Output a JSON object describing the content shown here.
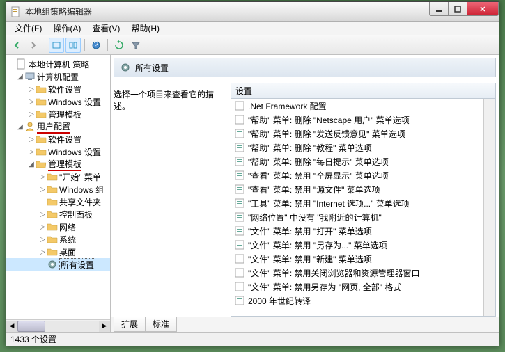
{
  "window": {
    "title": "本地组策略编辑器"
  },
  "menu": {
    "file": "文件(F)",
    "action": "操作(A)",
    "view": "查看(V)",
    "help": "帮助(H)"
  },
  "tree": {
    "root": "本地计算机 策略",
    "computer_config": "计算机配置",
    "cc_software": "软件设置",
    "cc_windows": "Windows 设置",
    "cc_admin": "管理模板",
    "user_config": "用户配置",
    "uc_software": "软件设置",
    "uc_windows": "Windows 设置",
    "uc_admin": "管理模板",
    "start_menu": "\"开始\" 菜单",
    "windows_comp": "Windows 组",
    "shared_folders": "共享文件夹",
    "control_panel": "控制面板",
    "network": "网络",
    "system": "系统",
    "desktop": "桌面",
    "all_settings": "所有设置"
  },
  "content": {
    "header": "所有设置",
    "description": "选择一个项目来查看它的描述。",
    "list_header": "设置",
    "items": [
      ".Net Framework 配置",
      "\"帮助\" 菜单: 删除 \"Netscape 用户\" 菜单选项",
      "\"帮助\" 菜单: 删除 \"发送反馈意见\" 菜单选项",
      "\"帮助\" 菜单: 删除 \"教程\" 菜单选项",
      "\"帮助\" 菜单: 删除 \"每日提示\" 菜单选项",
      "\"查看\" 菜单: 禁用 \"全屏显示\" 菜单选项",
      "\"查看\" 菜单: 禁用 \"源文件\" 菜单选项",
      "\"工具\" 菜单: 禁用 \"Internet 选项...\" 菜单选项",
      "\"网络位置\" 中没有 \"我附近的计算机\"",
      "\"文件\" 菜单: 禁用 \"打开\" 菜单选项",
      "\"文件\" 菜单: 禁用 \"另存为...\" 菜单选项",
      "\"文件\" 菜单: 禁用 \"新建\" 菜单选项",
      "\"文件\" 菜单: 禁用关闭浏览器和资源管理器窗口",
      "\"文件\" 菜单: 禁用另存为 \"网页, 全部\" 格式",
      "2000 年世纪转译"
    ]
  },
  "tabs": {
    "extended": "扩展",
    "standard": "标准"
  },
  "status": "1433 个设置"
}
